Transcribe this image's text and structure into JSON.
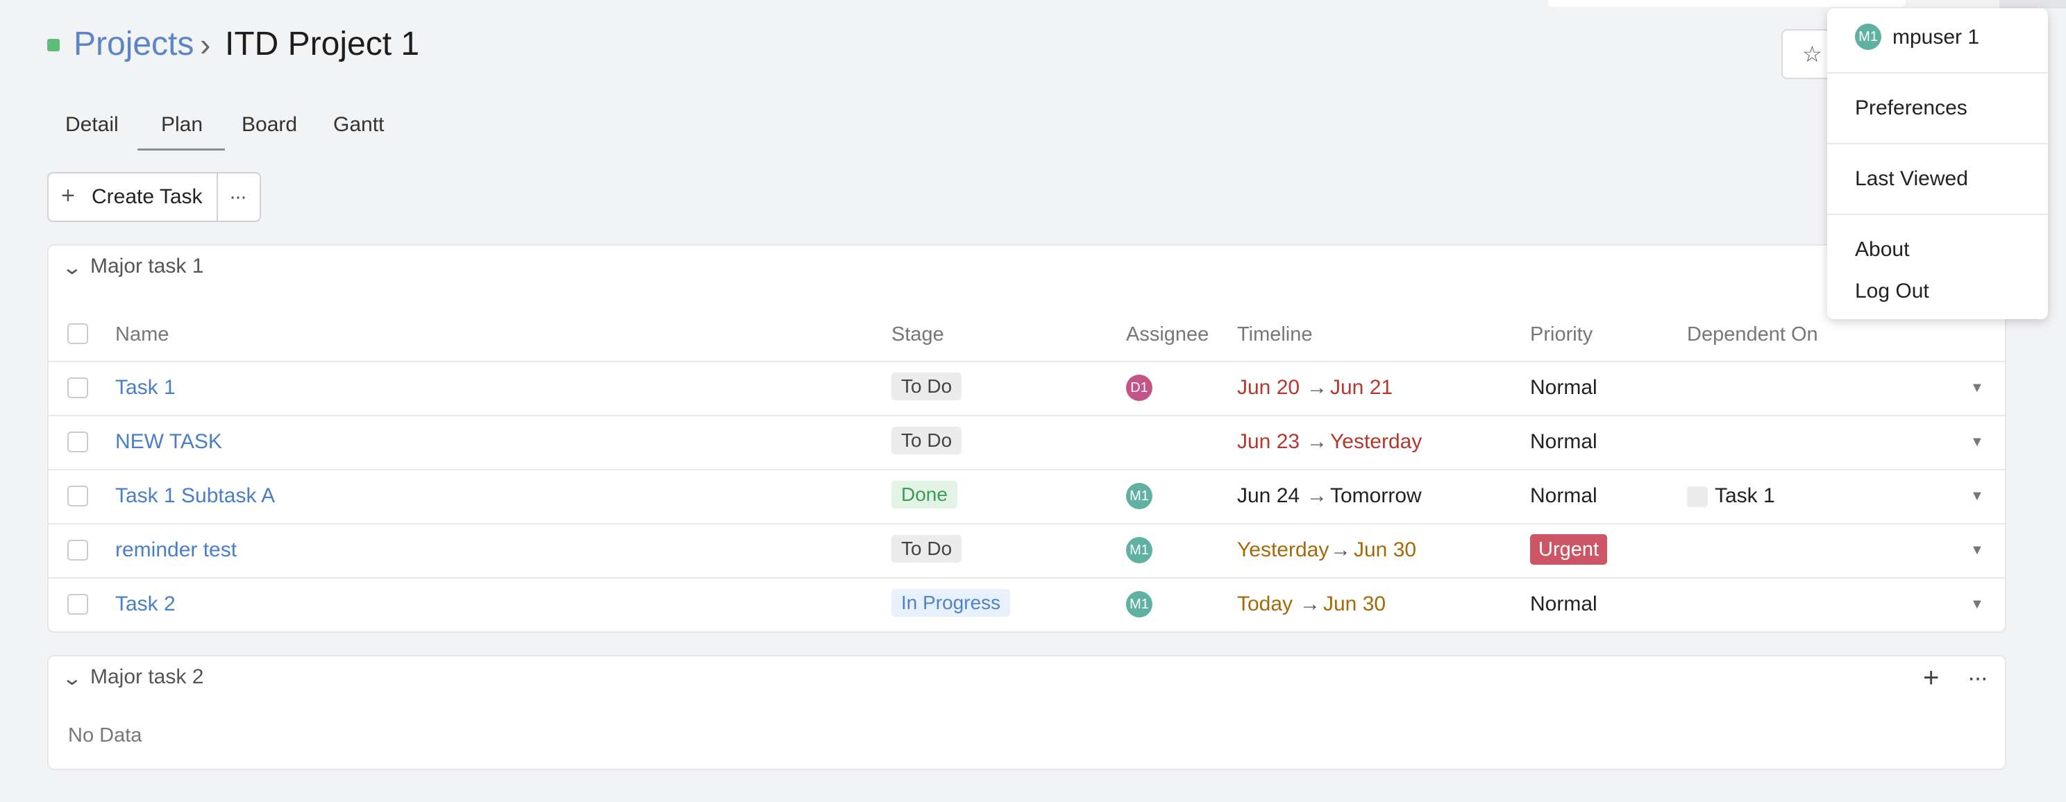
{
  "breadcrumb": {
    "projects": "Projects",
    "separator": "›",
    "current": "ITD Project 1"
  },
  "tabs": [
    "Detail",
    "Plan",
    "Board",
    "Gantt"
  ],
  "active_tab": "Plan",
  "toolbar": {
    "create_label": "Create Task",
    "plus_glyph": "+",
    "more_glyph": "···"
  },
  "group1": {
    "title": "Major task 1",
    "columns": {
      "name": "Name",
      "stage": "Stage",
      "assignee": "Assignee",
      "timeline": "Timeline",
      "priority": "Priority",
      "dependent": "Dependent On"
    },
    "rows": [
      {
        "name": "Task 1",
        "stage": "To Do",
        "assignee": "D1",
        "start": "Jun 20",
        "arrow": "→",
        "end": "Jun 21",
        "priority": "Normal",
        "dependent": ""
      },
      {
        "name": "NEW TASK",
        "stage": "To Do",
        "assignee": "",
        "start": "Jun 23",
        "arrow": "→",
        "end": "Yesterday",
        "priority": "Normal",
        "dependent": ""
      },
      {
        "name": "Task 1 Subtask A",
        "stage": "Done",
        "assignee": "M1",
        "start": "Jun 24",
        "arrow": "→",
        "end": "Tomorrow",
        "priority": "Normal",
        "dependent": "Task 1"
      },
      {
        "name": "reminder test",
        "stage": "To Do",
        "assignee": "M1",
        "start": "Yesterday",
        "arrow": "→",
        "end": "Jun 30",
        "priority": "Urgent",
        "dependent": ""
      },
      {
        "name": "Task 2",
        "stage": "In Progress",
        "assignee": "M1",
        "start": "Today",
        "arrow": "→",
        "end": "Jun 30",
        "priority": "Normal",
        "dependent": ""
      }
    ]
  },
  "group2": {
    "title": "Major task 2",
    "empty_text": "No Data",
    "plus_glyph": "+",
    "more_glyph": "···"
  },
  "user_menu": {
    "avatar": "M1",
    "username": "mpuser 1",
    "items": [
      "Preferences",
      "Last Viewed",
      "About",
      "Log Out"
    ]
  },
  "icons": {
    "star": "☆",
    "chevron": "⌄",
    "caret": "▼"
  },
  "colors": {
    "link": "#5b84c9",
    "done": "#3d9c53",
    "in_progress": "#4f83c8",
    "urgent": "#cc5566",
    "overdue": "#b5382e",
    "soon": "#a36a0a",
    "avatar_d1": "#c65387",
    "avatar_m1": "#5fb1a1"
  }
}
